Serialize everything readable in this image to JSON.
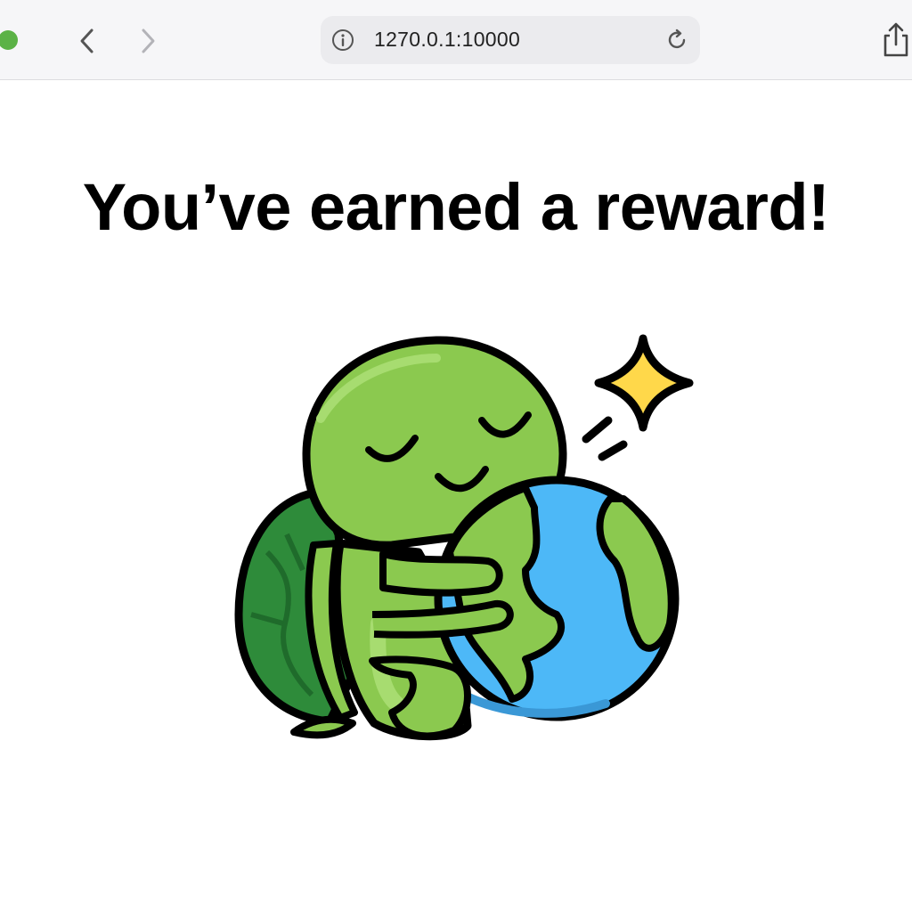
{
  "browser": {
    "url": "1270.0.1:10000",
    "icons": {
      "back": "chevron-left-icon",
      "forward": "chevron-right-icon",
      "info": "info-icon",
      "reload": "reload-icon",
      "share": "share-icon"
    }
  },
  "page": {
    "headline": "You’ve earned a reward!",
    "illustration": "turtle-hugging-earth-with-sparkle"
  },
  "colors": {
    "turtle_green": "#8bc94f",
    "shell_green": "#2e8b3a",
    "ocean_blue": "#4db8f7",
    "sparkle_yellow": "#ffd84a",
    "traffic_green": "#5bb246"
  }
}
